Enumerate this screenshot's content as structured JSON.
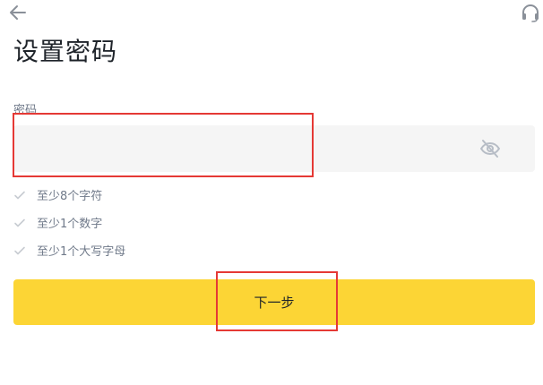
{
  "header": {
    "back_icon": "arrow-left-icon",
    "support_icon": "headset-icon"
  },
  "page_title": "设置密码",
  "password_field": {
    "label": "密码",
    "value": "",
    "placeholder": "",
    "visibility_icon": "eye-off-icon"
  },
  "requirements": [
    {
      "text": "至少8个字符",
      "met": false
    },
    {
      "text": "至少1个数字",
      "met": false
    },
    {
      "text": "至少1个大写字母",
      "met": false
    }
  ],
  "next_button": {
    "label": "下一步"
  },
  "colors": {
    "accent": "#fcd535",
    "input_bg": "#f5f5f5",
    "muted_text": "#707a8a",
    "highlight": "#e53935"
  }
}
